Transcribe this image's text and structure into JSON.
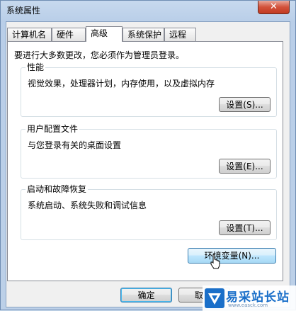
{
  "window": {
    "title": "系统属性",
    "close_glyph": "✕"
  },
  "tabs": [
    {
      "label": "计算机名",
      "active": false
    },
    {
      "label": "硬件",
      "active": false
    },
    {
      "label": "高级",
      "active": true
    },
    {
      "label": "系统保护",
      "active": false
    },
    {
      "label": "远程",
      "active": false
    }
  ],
  "advanced": {
    "admin_note": "要进行大多数更改，您必须作为管理员登录。",
    "performance": {
      "legend": "性能",
      "description": "视觉效果，处理器计划，内存使用，以及虚拟内存",
      "button": "设置(S)..."
    },
    "user_profiles": {
      "legend": "用户配置文件",
      "description": "与您登录有关的桌面设置",
      "button": "设置(E)..."
    },
    "startup_recovery": {
      "legend": "启动和故障恢复",
      "description": "系统启动、系统失败和调试信息",
      "button": "设置(T)..."
    },
    "env_vars_button": "环境变量(N)..."
  },
  "footer": {
    "ok": "确定",
    "cancel_partial": "取"
  },
  "watermark": {
    "text": "易采站长站",
    "sub": "www.easck.com"
  },
  "colors": {
    "accent_blue": "#3c7fb1",
    "close_red": "#c23b22",
    "watermark_blue": "#1a6fc9"
  }
}
